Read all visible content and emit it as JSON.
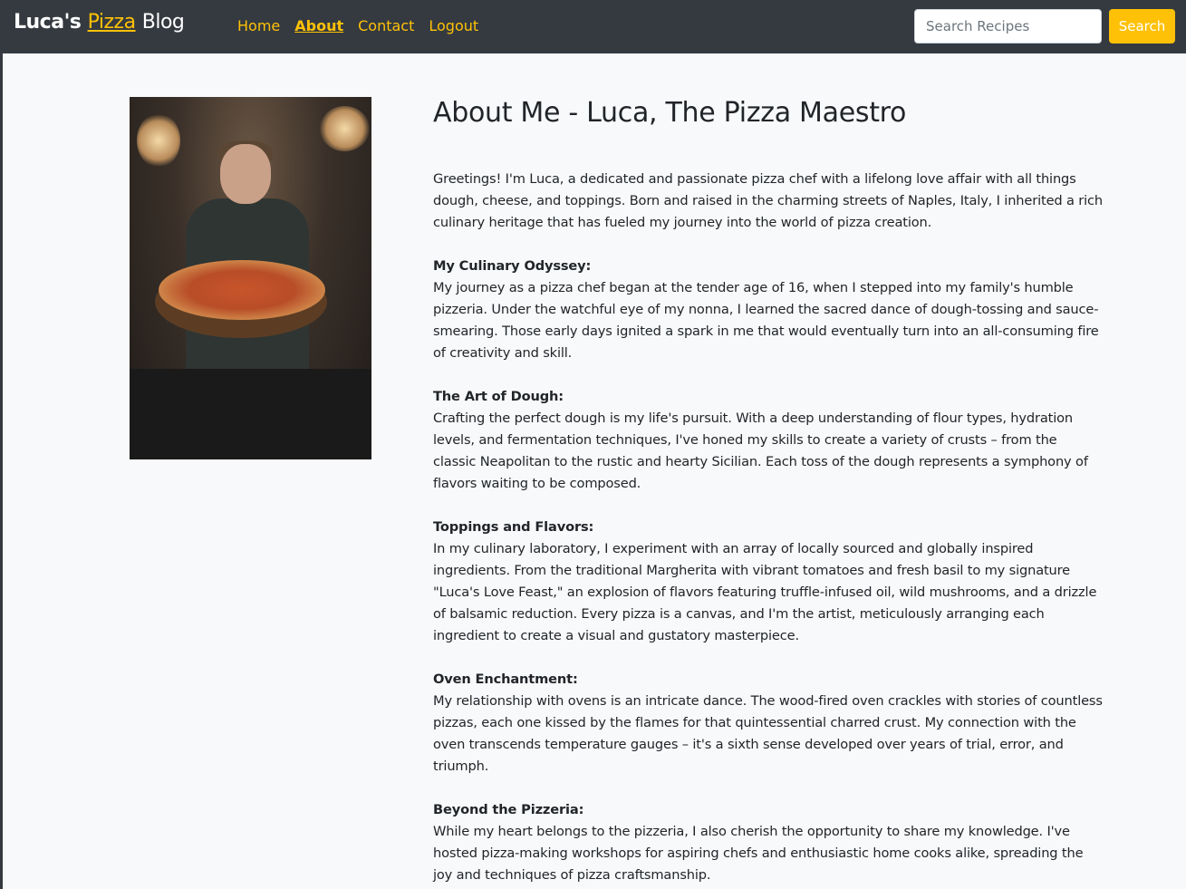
{
  "brand": {
    "prefix": "Luca's",
    "accent": "Pizza",
    "suffix": "Blog"
  },
  "nav": {
    "items": [
      {
        "label": "Home"
      },
      {
        "label": "About",
        "active": true
      },
      {
        "label": "Contact"
      },
      {
        "label": "Logout"
      }
    ]
  },
  "search": {
    "placeholder": "Search Recipes",
    "button_label": "Search"
  },
  "colors": {
    "navbar_bg": "#343a40",
    "accent": "#ffc107",
    "page_bg": "#f8f9fa",
    "text": "#212529"
  },
  "photo": {
    "alt": "Luca holding a pizza"
  },
  "page": {
    "title": "About Me - Luca, The Pizza Maestro",
    "intro": "Greetings! I'm Luca, a dedicated and passionate pizza chef with a lifelong love affair with all things dough, cheese, and toppings. Born and raised in the charming streets of Naples, Italy, I inherited a rich culinary heritage that has fueled my journey into the world of pizza creation.",
    "sections": [
      {
        "heading": "My Culinary Odyssey:",
        "body": "My journey as a pizza chef began at the tender age of 16, when I stepped into my family's humble pizzeria. Under the watchful eye of my nonna, I learned the sacred dance of dough-tossing and sauce-smearing. Those early days ignited a spark in me that would eventually turn into an all-consuming fire of creativity and skill."
      },
      {
        "heading": "The Art of Dough:",
        "body": "Crafting the perfect dough is my life's pursuit. With a deep understanding of flour types, hydration levels, and fermentation techniques, I've honed my skills to create a variety of crusts – from the classic Neapolitan to the rustic and hearty Sicilian. Each toss of the dough represents a symphony of flavors waiting to be composed."
      },
      {
        "heading": "Toppings and Flavors:",
        "body": "In my culinary laboratory, I experiment with an array of locally sourced and globally inspired ingredients. From the traditional Margherita with vibrant tomatoes and fresh basil to my signature \"Luca's Love Feast,\" an explosion of flavors featuring truffle-infused oil, wild mushrooms, and a drizzle of balsamic reduction. Every pizza is a canvas, and I'm the artist, meticulously arranging each ingredient to create a visual and gustatory masterpiece."
      },
      {
        "heading": "Oven Enchantment:",
        "body": "My relationship with ovens is an intricate dance. The wood-fired oven crackles with stories of countless pizzas, each one kissed by the flames for that quintessential charred crust. My connection with the oven transcends temperature gauges – it's a sixth sense developed over years of trial, error, and triumph."
      },
      {
        "heading": "Beyond the Pizzeria:",
        "body": "While my heart belongs to the pizzeria, I also cherish the opportunity to share my knowledge. I've hosted pizza-making workshops for aspiring chefs and enthusiastic home cooks alike, spreading the joy and techniques of pizza craftsmanship."
      }
    ]
  }
}
